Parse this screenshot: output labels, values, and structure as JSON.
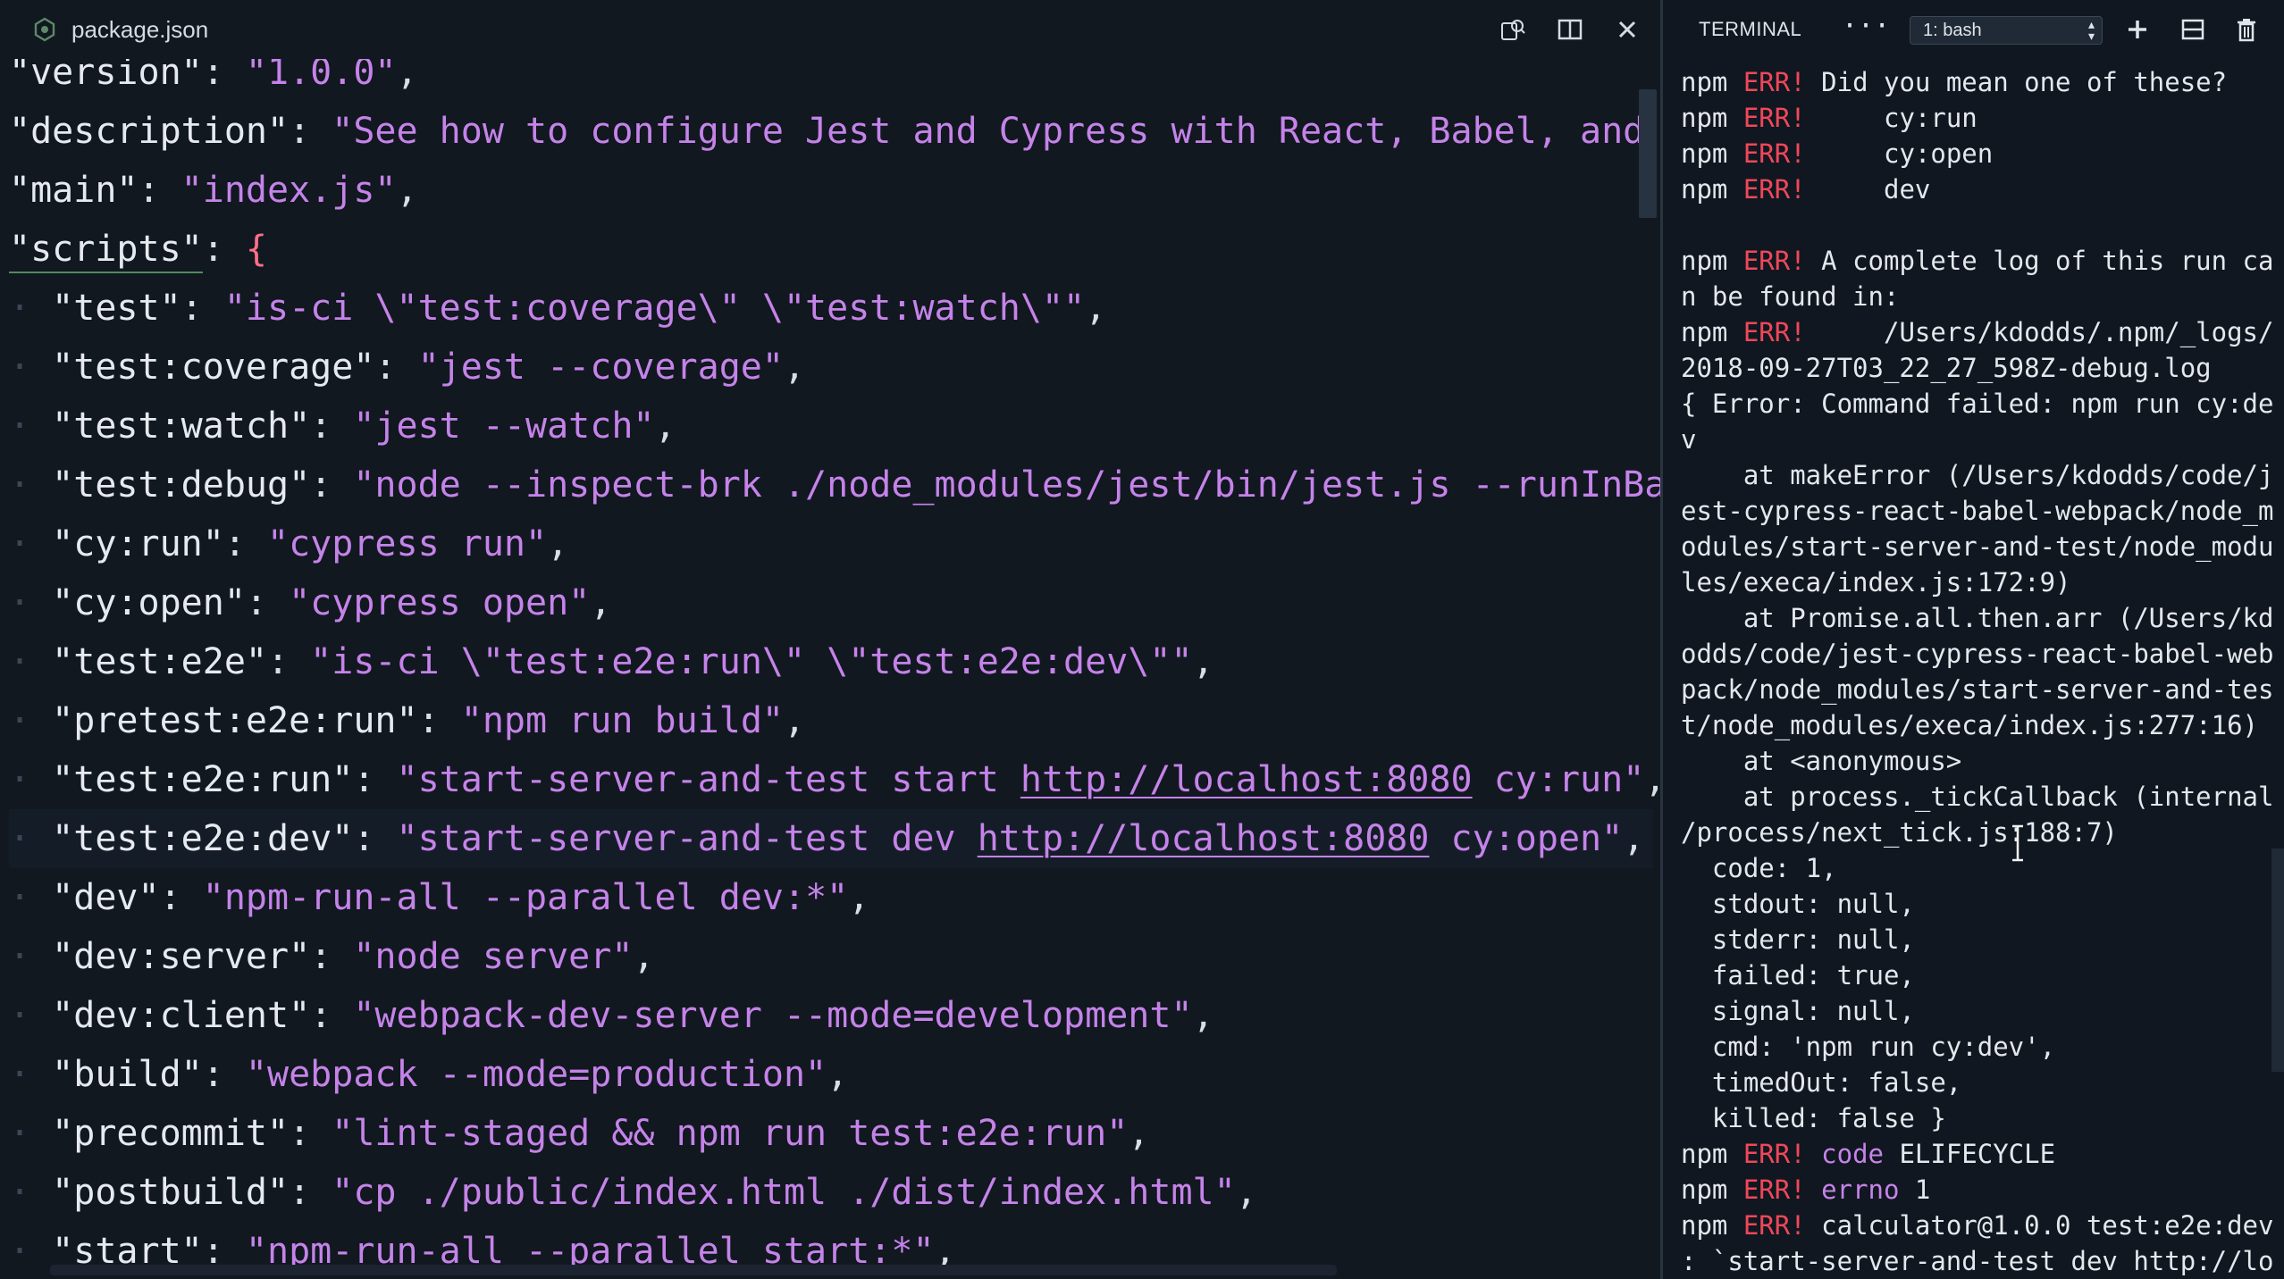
{
  "editor": {
    "tab_title": "package.json",
    "icons": [
      "json-file-icon",
      "open-preview-icon",
      "split-editor-icon",
      "close-icon"
    ],
    "lines": [
      [
        {
          "t": "k",
          "v": "\"version\""
        },
        {
          "t": "p",
          "v": ": "
        },
        {
          "t": "s",
          "v": "\"1.0.0\""
        },
        {
          "t": "p",
          "v": ","
        }
      ],
      [
        {
          "t": "k",
          "v": "\"description\""
        },
        {
          "t": "p",
          "v": ": "
        },
        {
          "t": "s",
          "v": "\"See how to configure Jest and Cypress with React, Babel, and"
        }
      ],
      [
        {
          "t": "k",
          "v": "\"main\""
        },
        {
          "t": "p",
          "v": ": "
        },
        {
          "t": "s",
          "v": "\"index.js\""
        },
        {
          "t": "p",
          "v": ","
        }
      ],
      [
        {
          "t": "k",
          "v": "\"scripts\"",
          "cls": "squiggle"
        },
        {
          "t": "p",
          "v": ": "
        },
        {
          "t": "b",
          "v": "{"
        }
      ],
      [
        {
          "t": "g",
          "v": "· "
        },
        {
          "t": "k",
          "v": "\"test\""
        },
        {
          "t": "p",
          "v": ": "
        },
        {
          "t": "s",
          "v": "\"is-ci \\\"test:coverage\\\" \\\"test:watch\\\"\""
        },
        {
          "t": "p",
          "v": ","
        }
      ],
      [
        {
          "t": "g",
          "v": "· "
        },
        {
          "t": "k",
          "v": "\"test:coverage\""
        },
        {
          "t": "p",
          "v": ": "
        },
        {
          "t": "s",
          "v": "\"jest --coverage\""
        },
        {
          "t": "p",
          "v": ","
        }
      ],
      [
        {
          "t": "g",
          "v": "· "
        },
        {
          "t": "k",
          "v": "\"test:watch\""
        },
        {
          "t": "p",
          "v": ": "
        },
        {
          "t": "s",
          "v": "\"jest --watch\""
        },
        {
          "t": "p",
          "v": ","
        }
      ],
      [
        {
          "t": "g",
          "v": "· "
        },
        {
          "t": "k",
          "v": "\"test:debug\""
        },
        {
          "t": "p",
          "v": ": "
        },
        {
          "t": "s",
          "v": "\"node --inspect-brk ./node_modules/jest/bin/jest.js --runInBa"
        }
      ],
      [
        {
          "t": "g",
          "v": "· "
        },
        {
          "t": "k",
          "v": "\"cy:run\""
        },
        {
          "t": "p",
          "v": ": "
        },
        {
          "t": "s",
          "v": "\"cypress run\""
        },
        {
          "t": "p",
          "v": ","
        }
      ],
      [
        {
          "t": "g",
          "v": "· "
        },
        {
          "t": "k",
          "v": "\"cy:open\""
        },
        {
          "t": "p",
          "v": ": "
        },
        {
          "t": "s",
          "v": "\"cypress open\""
        },
        {
          "t": "p",
          "v": ","
        }
      ],
      [
        {
          "t": "g",
          "v": "· "
        },
        {
          "t": "k",
          "v": "\"test:e2e\""
        },
        {
          "t": "p",
          "v": ": "
        },
        {
          "t": "s",
          "v": "\"is-ci \\\"test:e2e:run\\\" \\\"test:e2e:dev\\\"\""
        },
        {
          "t": "p",
          "v": ","
        }
      ],
      [
        {
          "t": "g",
          "v": "· "
        },
        {
          "t": "k",
          "v": "\"pretest:e2e:run\""
        },
        {
          "t": "p",
          "v": ": "
        },
        {
          "t": "s",
          "v": "\"npm run build\""
        },
        {
          "t": "p",
          "v": ","
        }
      ],
      [
        {
          "t": "g",
          "v": "· "
        },
        {
          "t": "k",
          "v": "\"test:e2e:run\""
        },
        {
          "t": "p",
          "v": ": "
        },
        {
          "t": "s",
          "v": "\"start-server-and-test start "
        },
        {
          "t": "u",
          "v": "http://localhost:8080"
        },
        {
          "t": "s",
          "v": " cy:run\""
        },
        {
          "t": "p",
          "v": ","
        }
      ],
      [
        {
          "t": "g",
          "v": "· "
        },
        {
          "t": "k",
          "v": "\"test:e2e:dev\""
        },
        {
          "t": "p",
          "v": ": "
        },
        {
          "t": "s",
          "v": "\"start-server-and-test dev "
        },
        {
          "t": "u",
          "v": "http://localhost:8080"
        },
        {
          "t": "s",
          "v": " cy:open\""
        },
        {
          "t": "p",
          "v": ","
        }
      ],
      [
        {
          "t": "g",
          "v": "· "
        },
        {
          "t": "k",
          "v": "\"dev\""
        },
        {
          "t": "p",
          "v": ": "
        },
        {
          "t": "s",
          "v": "\"npm-run-all --parallel dev:*\""
        },
        {
          "t": "p",
          "v": ","
        }
      ],
      [
        {
          "t": "g",
          "v": "· "
        },
        {
          "t": "k",
          "v": "\"dev:server\""
        },
        {
          "t": "p",
          "v": ": "
        },
        {
          "t": "s",
          "v": "\"node server\""
        },
        {
          "t": "p",
          "v": ","
        }
      ],
      [
        {
          "t": "g",
          "v": "· "
        },
        {
          "t": "k",
          "v": "\"dev:client\""
        },
        {
          "t": "p",
          "v": ": "
        },
        {
          "t": "s",
          "v": "\"webpack-dev-server --mode=development\""
        },
        {
          "t": "p",
          "v": ","
        }
      ],
      [
        {
          "t": "g",
          "v": "· "
        },
        {
          "t": "k",
          "v": "\"build\""
        },
        {
          "t": "p",
          "v": ": "
        },
        {
          "t": "s",
          "v": "\"webpack --mode=production\""
        },
        {
          "t": "p",
          "v": ","
        }
      ],
      [
        {
          "t": "g",
          "v": "· "
        },
        {
          "t": "k",
          "v": "\"precommit\""
        },
        {
          "t": "p",
          "v": ": "
        },
        {
          "t": "s",
          "v": "\"lint-staged && npm run test:e2e:run\""
        },
        {
          "t": "p",
          "v": ","
        }
      ],
      [
        {
          "t": "g",
          "v": "· "
        },
        {
          "t": "k",
          "v": "\"postbuild\""
        },
        {
          "t": "p",
          "v": ": "
        },
        {
          "t": "s",
          "v": "\"cp ./public/index.html ./dist/index.html\""
        },
        {
          "t": "p",
          "v": ","
        }
      ],
      [
        {
          "t": "g",
          "v": "· "
        },
        {
          "t": "k",
          "v": "\"start\""
        },
        {
          "t": "p",
          "v": ": "
        },
        {
          "t": "s",
          "v": "\"npm-run-all --parallel start:*\""
        },
        {
          "t": "p",
          "v": ","
        }
      ]
    ],
    "current_line": 13
  },
  "terminal": {
    "title": "TERMINAL",
    "more_label": "···",
    "shell_select": "1: bash",
    "icons": [
      "plus-icon",
      "split-terminal-icon",
      "trash-icon"
    ],
    "lines": [
      [
        {
          "t": "n",
          "v": "npm "
        },
        {
          "t": "e",
          "v": "ERR!"
        },
        {
          "t": "n",
          "v": " Did you mean one of these?"
        }
      ],
      [
        {
          "t": "n",
          "v": "npm "
        },
        {
          "t": "e",
          "v": "ERR!"
        },
        {
          "t": "n",
          "v": "     cy:run"
        }
      ],
      [
        {
          "t": "n",
          "v": "npm "
        },
        {
          "t": "e",
          "v": "ERR!"
        },
        {
          "t": "n",
          "v": "     cy:open"
        }
      ],
      [
        {
          "t": "n",
          "v": "npm "
        },
        {
          "t": "e",
          "v": "ERR!"
        },
        {
          "t": "n",
          "v": "     dev"
        }
      ],
      [],
      [
        {
          "t": "n",
          "v": "npm "
        },
        {
          "t": "e",
          "v": "ERR!"
        },
        {
          "t": "n",
          "v": " A complete log of this run ca"
        }
      ],
      [
        {
          "t": "n",
          "v": "n be found in:"
        }
      ],
      [
        {
          "t": "n",
          "v": "npm "
        },
        {
          "t": "e",
          "v": "ERR!"
        },
        {
          "t": "n",
          "v": "     /Users/kdodds/.npm/_logs/"
        }
      ],
      [
        {
          "t": "n",
          "v": "2018-09-27T03_22_27_598Z-debug.log"
        }
      ],
      [
        {
          "t": "n",
          "v": "{ Error: Command failed: npm run cy:de"
        }
      ],
      [
        {
          "t": "n",
          "v": "v"
        }
      ],
      [
        {
          "t": "n",
          "v": "    at makeError (/Users/kdodds/code/j"
        }
      ],
      [
        {
          "t": "n",
          "v": "est-cypress-react-babel-webpack/node_m"
        }
      ],
      [
        {
          "t": "n",
          "v": "odules/start-server-and-test/node_modu"
        }
      ],
      [
        {
          "t": "n",
          "v": "les/execa/index.js:172:9)"
        }
      ],
      [
        {
          "t": "n",
          "v": "    at Promise.all.then.arr (/Users/kd"
        }
      ],
      [
        {
          "t": "n",
          "v": "odds/code/jest-cypress-react-babel-web"
        }
      ],
      [
        {
          "t": "n",
          "v": "pack/node_modules/start-server-and-tes"
        }
      ],
      [
        {
          "t": "n",
          "v": "t/node_modules/execa/index.js:277:16)"
        }
      ],
      [
        {
          "t": "n",
          "v": "    at <anonymous>"
        }
      ],
      [
        {
          "t": "n",
          "v": "    at process._tickCallback (internal"
        }
      ],
      [
        {
          "t": "n",
          "v": "/process/next_tick.js:188:7)"
        }
      ],
      [
        {
          "t": "n",
          "v": "  code: 1,"
        }
      ],
      [
        {
          "t": "n",
          "v": "  stdout: null,"
        }
      ],
      [
        {
          "t": "n",
          "v": "  stderr: null,"
        }
      ],
      [
        {
          "t": "n",
          "v": "  failed: true,"
        }
      ],
      [
        {
          "t": "n",
          "v": "  signal: null,"
        }
      ],
      [
        {
          "t": "n",
          "v": "  cmd: 'npm run cy:dev',"
        }
      ],
      [
        {
          "t": "n",
          "v": "  timedOut: false,"
        }
      ],
      [
        {
          "t": "n",
          "v": "  killed: false }"
        }
      ],
      [
        {
          "t": "n",
          "v": "npm "
        },
        {
          "t": "e",
          "v": "ERR!"
        },
        {
          "t": "n",
          "v": " "
        },
        {
          "t": "w",
          "v": "code"
        },
        {
          "t": "n",
          "v": " ELIFECYCLE"
        }
      ],
      [
        {
          "t": "n",
          "v": "npm "
        },
        {
          "t": "e",
          "v": "ERR!"
        },
        {
          "t": "n",
          "v": " "
        },
        {
          "t": "w",
          "v": "errno"
        },
        {
          "t": "n",
          "v": " 1"
        }
      ],
      [
        {
          "t": "n",
          "v": "npm "
        },
        {
          "t": "e",
          "v": "ERR!"
        },
        {
          "t": "n",
          "v": " calculator@1.0.0 test:e2e:dev"
        }
      ],
      [
        {
          "t": "n",
          "v": ": `start-server-and-test dev http://lo"
        }
      ]
    ]
  },
  "colors": {
    "editor_bg": "#111820",
    "terminal_bg": "#101720",
    "json_key": "#e6e9ef",
    "json_string": "#c583e9",
    "json_brace": "#ff6f8a",
    "npm_err": "#f0475a"
  }
}
